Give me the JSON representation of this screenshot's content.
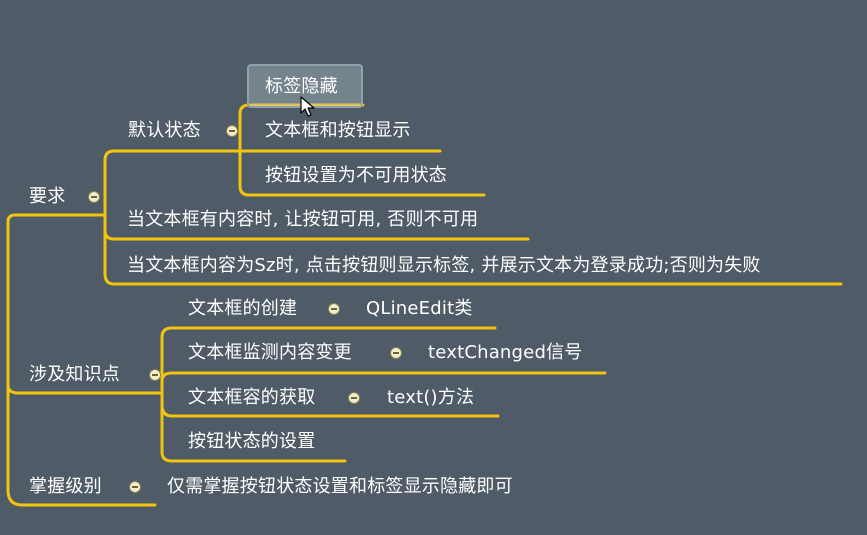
{
  "colors": {
    "background": "#4f5b66",
    "branch_line": "#f1c40f",
    "text": "#ffffff"
  },
  "mindmap": {
    "requirements": {
      "label": "要求",
      "default_state": {
        "label": "默认状态",
        "items": [
          "标签隐藏",
          "文本框和按钮显示",
          "按钮设置为不可用状态"
        ]
      },
      "rule_1": "当文本框有内容时, 让按钮可用, 否则不可用",
      "rule_2": "当文本框内容为Sz时, 点击按钮则显示标签, 并展示文本为登录成功;否则为失败"
    },
    "knowledge": {
      "label": "涉及知识点",
      "items": [
        {
          "label": "文本框的创建",
          "detail": "QLineEdit类"
        },
        {
          "label": "文本框监测内容变更",
          "detail": "textChanged信号"
        },
        {
          "label": "文本框容的获取",
          "detail": "text()方法"
        },
        {
          "label": "按钮状态的设置",
          "detail": ""
        }
      ]
    },
    "mastery": {
      "label": "掌握级别",
      "detail": "仅需掌握按钮状态设置和标签显示隐藏即可"
    }
  }
}
